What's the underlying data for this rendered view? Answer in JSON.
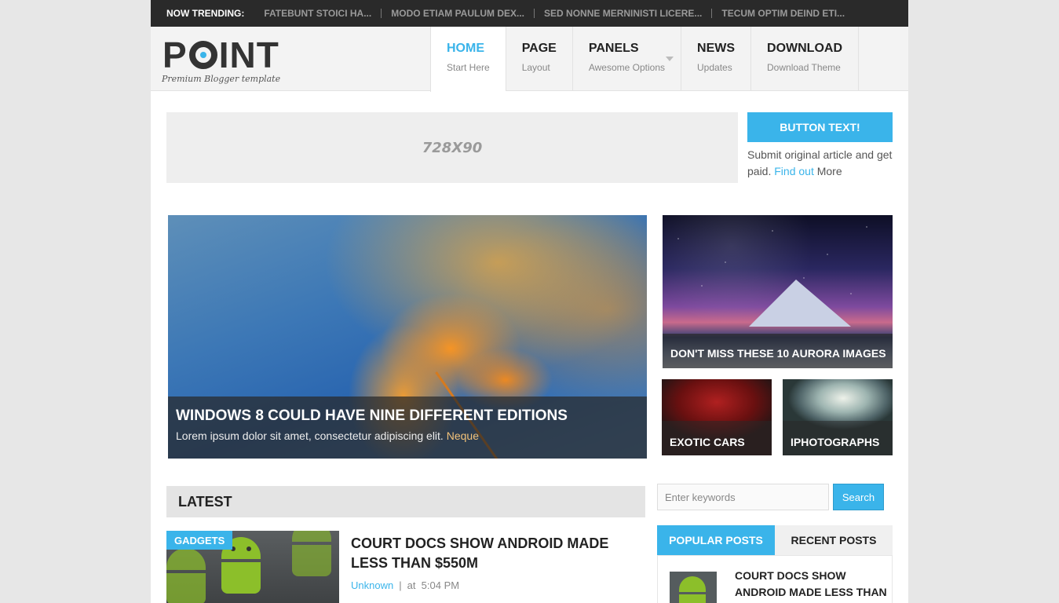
{
  "trending": {
    "label": "NOW TRENDING:",
    "items": [
      "FATEBUNT STOICI HA...",
      "MODO ETIAM PAULUM DEX...",
      "SED NONNE MERNINISTI LICERE...",
      "TECUM OPTIM DEIND ETI..."
    ]
  },
  "logo": {
    "subtitle": "Premium Blogger template"
  },
  "nav": [
    {
      "title": "HOME",
      "subtitle": "Start Here",
      "active": true
    },
    {
      "title": "PAGE",
      "subtitle": "Layout"
    },
    {
      "title": "PANELS",
      "subtitle": "Awesome Options",
      "has_dropdown": true
    },
    {
      "title": "NEWS",
      "subtitle": "Updates"
    },
    {
      "title": "DOWNLOAD",
      "subtitle": "Download Theme"
    }
  ],
  "ad": {
    "label": "728X90"
  },
  "cta": {
    "button": "BUTTON TEXT!",
    "text_before": "Submit original article and get paid. ",
    "link": "Find out",
    "text_after": " More"
  },
  "featured": {
    "main": {
      "title": "WINDOWS 8 COULD HAVE NINE DIFFERENT EDITIONS",
      "excerpt": "Lorem ipsum dolor sit amet, consectetur adipiscing elit. ",
      "excerpt_more": "Neque"
    },
    "side_top": {
      "title": "DON'T MISS THESE 10 AURORA IMAGES"
    },
    "small_left": {
      "title": "EXOTIC CARS"
    },
    "small_right": {
      "title": "IPHOTOGRAPHS"
    }
  },
  "latest": {
    "heading": "LATEST",
    "post": {
      "tag": "GADGETS",
      "title": "COURT DOCS SHOW ANDROID MADE LESS THAN $550M",
      "author": "Unknown",
      "at": "at",
      "time": "5:04 PM"
    }
  },
  "sidebar": {
    "search_placeholder": "Enter keywords",
    "search_button": "Search",
    "tabs": [
      "POPULAR POSTS",
      "RECENT POSTS"
    ],
    "popular_first_title": "COURT DOCS SHOW ANDROID MADE LESS THAN"
  },
  "colors": {
    "accent": "#3ab4ea",
    "topbar": "#2a2a2a",
    "header": "#f3f3f3"
  }
}
